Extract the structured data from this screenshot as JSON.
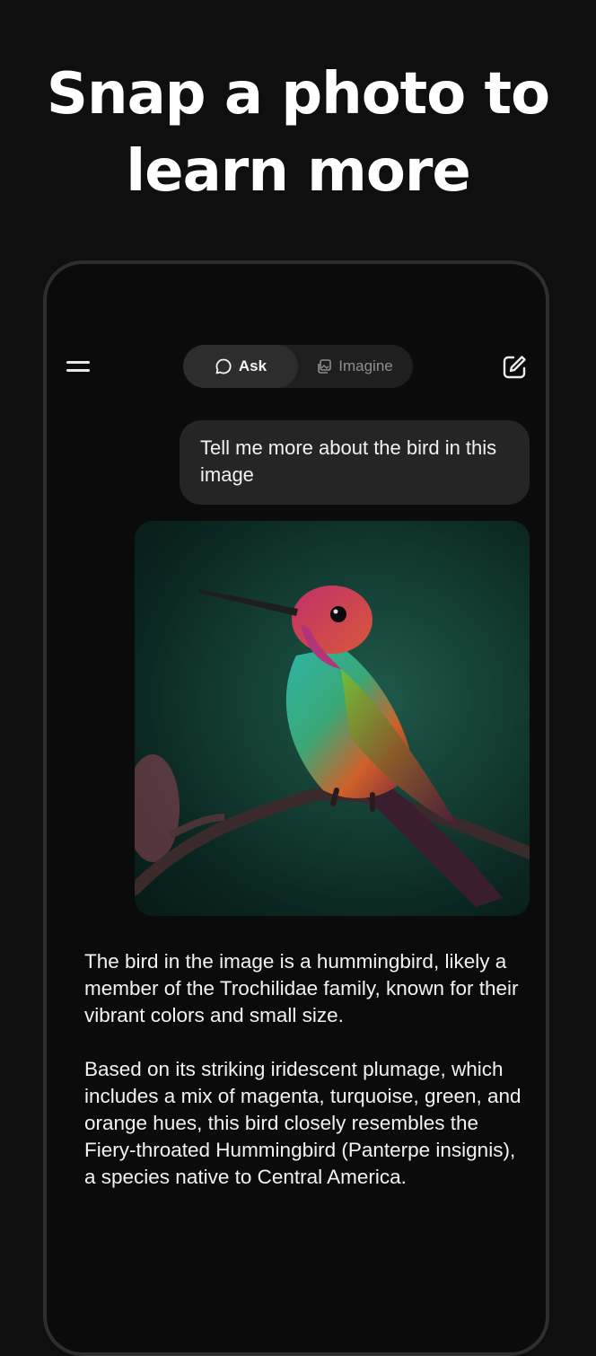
{
  "headline": {
    "line1": "Snap a photo to",
    "line2": "learn more"
  },
  "topbar": {
    "menu_icon": "hamburger-icon",
    "tabs": [
      {
        "label": "Ask",
        "icon": "chat-bubble-icon",
        "selected": true
      },
      {
        "label": "Imagine",
        "icon": "image-stack-icon",
        "selected": false
      }
    ],
    "compose_icon": "new-chat-edit-icon"
  },
  "conversation": {
    "user_message": "Tell me more about the bird in this image",
    "image_subject": "hummingbird perched on branch",
    "answer_paragraphs": [
      "The bird in the image is a hummingbird, likely a member of the Trochilidae family, known for their vibrant colors and small size.",
      "Based on its striking iridescent plumage, which includes a mix of magenta, turquoise, green, and orange hues, this bird closely resembles the Fiery-throated Hummingbird (Panterpe insignis), a species native to Central America."
    ]
  },
  "colors": {
    "background": "#0f0f0f",
    "phone_border": "#2e2e2e",
    "bubble": "#252525",
    "toggle_active": "#2d2d2d",
    "toggle_inactive_text": "#8e8e8e"
  }
}
